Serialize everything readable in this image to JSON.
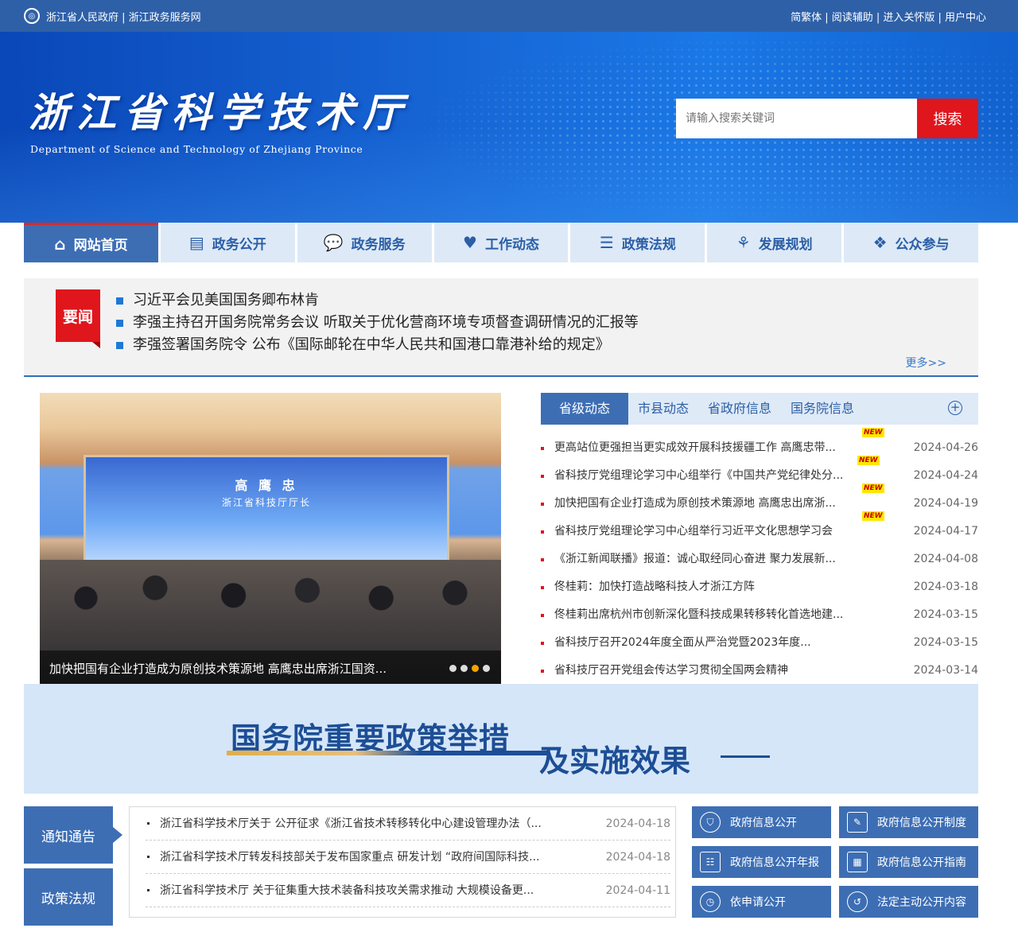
{
  "topbar": {
    "left": "浙江省人民政府 | 浙江政务服务网",
    "right": "简繁体 | 阅读辅助 | 进入关怀版 | 用户中心"
  },
  "banner": {
    "title": "浙江省科学技术厅",
    "subtitle": "Department of Science and Technology of Zhejiang Province",
    "search_placeholder": "请输入搜索关键词",
    "search_button": "搜索"
  },
  "nav": [
    {
      "label": "网站首页",
      "icon": "home-icon"
    },
    {
      "label": "政务公开",
      "icon": "list-icon"
    },
    {
      "label": "政务服务",
      "icon": "chat-icon"
    },
    {
      "label": "工作动态",
      "icon": "heart-icon"
    },
    {
      "label": "政策法规",
      "icon": "document-icon"
    },
    {
      "label": "发展规划",
      "icon": "handshake-icon"
    },
    {
      "label": "公众参与",
      "icon": "people-icon"
    }
  ],
  "yaowen": {
    "badge": "要闻",
    "items": [
      "习近平会见美国国务卿布林肯",
      "李强主持召开国务院常务会议 听取关于优化营商环境专项督查调研情况的汇报等",
      "李强签署国务院令 公布《国际邮轮在中华人民共和国港口靠港补给的规定》"
    ],
    "more": "更多>>"
  },
  "photo": {
    "screen_name": "高 鹰 忠",
    "screen_role": "浙江省科技厅厅长",
    "caption": "加快把国有企业打造成为原创技术策源地 高鹰忠出席浙江国资..."
  },
  "news": {
    "tabs": [
      "省级动态",
      "市县动态",
      "省政府信息",
      "国务院信息"
    ],
    "new_label": "NEW",
    "items": [
      {
        "title": "更高站位更强担当更实成效开展科技援疆工作 高鹰忠带...",
        "date": "2024-04-26",
        "new": true
      },
      {
        "title": "省科技厅党组理论学习中心组举行《中国共产党纪律处分...",
        "date": "2024-04-24",
        "new": true
      },
      {
        "title": "加快把国有企业打造成为原创技术策源地 高鹰忠出席浙...",
        "date": "2024-04-19",
        "new": true
      },
      {
        "title": "省科技厅党组理论学习中心组举行习近平文化思想学习会",
        "date": "2024-04-17",
        "new": true
      },
      {
        "title": "《浙江新闻联播》报道：诚心取经同心奋进 聚力发展新...",
        "date": "2024-04-08",
        "new": false
      },
      {
        "title": "佟桂莉：加快打造战略科技人才浙江方阵",
        "date": "2024-03-18",
        "new": false
      },
      {
        "title": "佟桂莉出席杭州市创新深化暨科技成果转移转化首选地建...",
        "date": "2024-03-15",
        "new": false
      },
      {
        "title": "省科技厅召开2024年度全面从严治党暨2023年度...",
        "date": "2024-03-15",
        "new": false
      },
      {
        "title": "省科技厅召开党组会传达学习贯彻全国两会精神",
        "date": "2024-03-14",
        "new": false
      }
    ]
  },
  "policy": {
    "line1": "国务院重要政策举措",
    "line2": "及实施效果"
  },
  "bottom": {
    "side1": "通知通告",
    "side2": "政策法规",
    "notices": [
      {
        "title": "浙江省科学技术厅关于 公开征求《浙江省技术转移转化中心建设管理办法（...",
        "date": "2024-04-18"
      },
      {
        "title": "浙江省科学技术厅转发科技部关于发布国家重点 研发计划 “政府间国际科技...",
        "date": "2024-04-18"
      },
      {
        "title": "浙江省科学技术厅 关于征集重大技术装备科技攻关需求推动 大规模设备更...",
        "date": "2024-04-11"
      }
    ],
    "gov_links": [
      {
        "label": "政府信息公开",
        "icon": "shield-icon"
      },
      {
        "label": "政府信息公开制度",
        "icon": "edit-icon"
      },
      {
        "label": "政府信息公开年报",
        "icon": "report-icon"
      },
      {
        "label": "政府信息公开指南",
        "icon": "chart-icon"
      },
      {
        "label": "依申请公开",
        "icon": "clock-icon"
      },
      {
        "label": "法定主动公开内容",
        "icon": "history-icon"
      }
    ]
  }
}
